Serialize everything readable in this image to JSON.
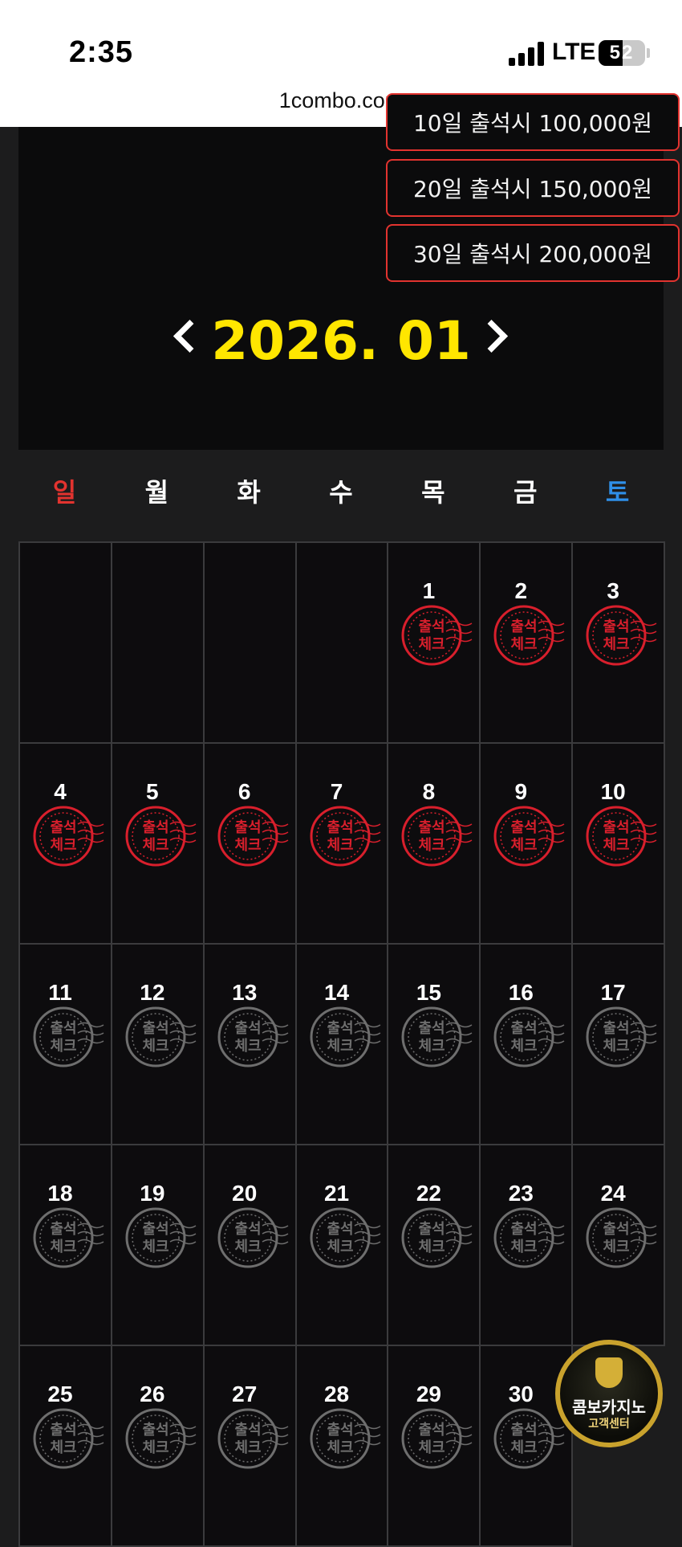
{
  "status_bar": {
    "time": "2:35",
    "network": "LTE",
    "battery": "52",
    "url": "1combo.com"
  },
  "rewards": [
    "10일 출석시 100,000원",
    "20일 출석시 150,000원",
    "30일 출석시 200,000원"
  ],
  "calendar": {
    "title": "2026. 01",
    "weekdays": [
      "일",
      "월",
      "화",
      "수",
      "목",
      "금",
      "토"
    ],
    "weekday_colors": [
      "#e2332f",
      "#ffffff",
      "#ffffff",
      "#ffffff",
      "#ffffff",
      "#ffffff",
      "#2f8fe8"
    ],
    "leading_blanks": 4,
    "days": [
      "1",
      "2",
      "3",
      "4",
      "5",
      "6",
      "7",
      "8",
      "9",
      "10",
      "11",
      "12",
      "13",
      "14",
      "15",
      "16",
      "17",
      "18",
      "19",
      "20",
      "21",
      "22",
      "23",
      "24",
      "25",
      "26",
      "27",
      "28",
      "29",
      "30"
    ],
    "checked_days": 10,
    "stamp_text": [
      "출석",
      "체크"
    ],
    "stamp_checked_color": "#d81f2c",
    "stamp_unchecked_color": "#6e6e6e"
  },
  "support_badge": {
    "line1": "콤보카지노",
    "line2": "고객센터"
  }
}
